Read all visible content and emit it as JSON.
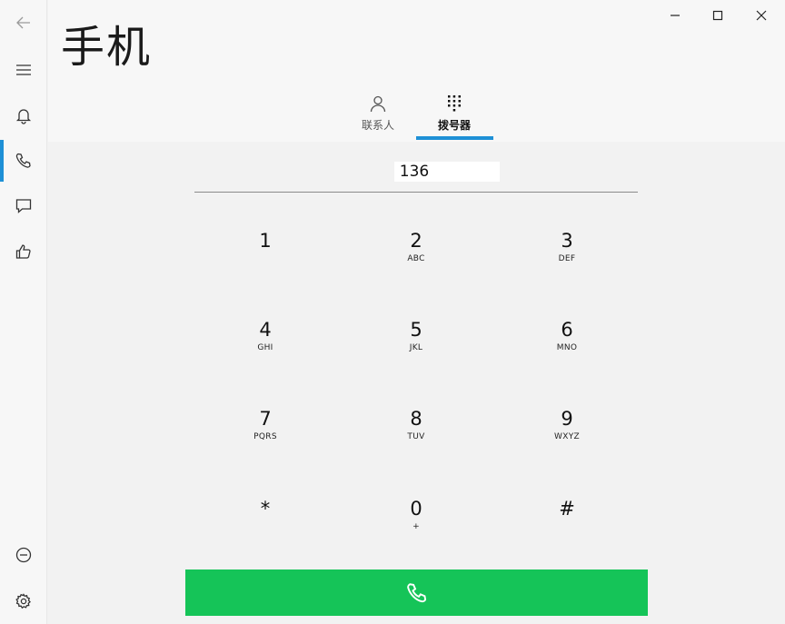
{
  "app": {
    "title": "手机"
  },
  "tabs": [
    {
      "id": "contacts",
      "label": "联系人",
      "icon": "person-icon"
    },
    {
      "id": "dialer",
      "label": "拨号器",
      "icon": "dialpad-icon",
      "selected": true
    }
  ],
  "dialer": {
    "number": "136",
    "keys": [
      {
        "digit": "1",
        "letters": ""
      },
      {
        "digit": "2",
        "letters": "ABC"
      },
      {
        "digit": "3",
        "letters": "DEF"
      },
      {
        "digit": "4",
        "letters": "GHI"
      },
      {
        "digit": "5",
        "letters": "JKL"
      },
      {
        "digit": "6",
        "letters": "MNO"
      },
      {
        "digit": "7",
        "letters": "PQRS"
      },
      {
        "digit": "8",
        "letters": "TUV"
      },
      {
        "digit": "9",
        "letters": "WXYZ"
      },
      {
        "digit": "*",
        "letters": ""
      },
      {
        "digit": "0",
        "letters": "+"
      },
      {
        "digit": "#",
        "letters": ""
      }
    ]
  },
  "sidebar": {
    "items": [
      "back-arrow-icon",
      "menu-icon",
      "bell-icon",
      "phone-icon",
      "message-icon",
      "thumbs-up-icon",
      "minus-circle-icon",
      "gear-icon"
    ]
  },
  "colors": {
    "accent": "#1e90d6",
    "call": "#15c458"
  }
}
